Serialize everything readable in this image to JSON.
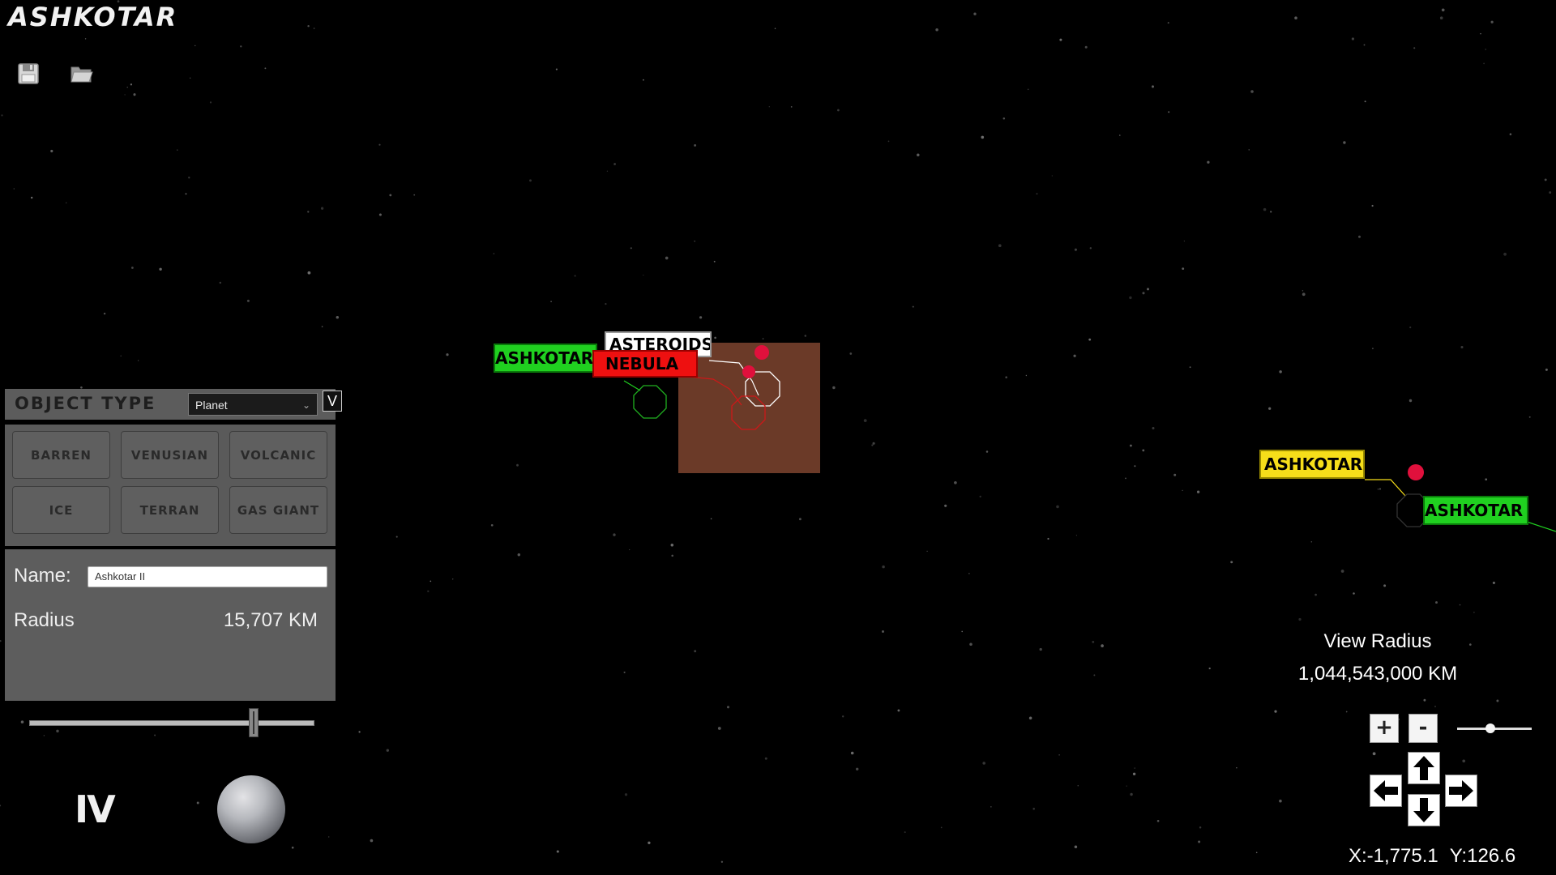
{
  "app": {
    "title": "ASHKOTAR"
  },
  "toolbar": {
    "save_icon": "save-icon",
    "open_icon": "open-folder-icon"
  },
  "object_type": {
    "label": "OBJECT TYPE",
    "selected": "Planet",
    "toggle_label": "V"
  },
  "planet_types": [
    "BARREN",
    "VENUSIAN",
    "VOLCANIC",
    "ICE",
    "TERRAN",
    "GAS GIANT"
  ],
  "properties": {
    "name_label": "Name:",
    "name_value": "Ashkotar II",
    "radius_label": "Radius",
    "radius_value": "15,707 KM",
    "radius_slider_fraction": 0.79
  },
  "preview": {
    "index_numeral": "IV",
    "planet_icon": "planet-preview"
  },
  "map_labels": {
    "ashkotar_green_1": "ASHKOTAR",
    "asteroids": "ASTEROIDS",
    "nebula": "NEBULA",
    "ashkotar_yellow": "ASHKOTAR",
    "ashkotar_green_2": "ASHKOTAR"
  },
  "view": {
    "radius_label": "View Radius",
    "radius_value": "1,044,543,000 KM",
    "zoom_in_label": "+",
    "zoom_out_label": "-",
    "zoom_slider_fraction": 0.45
  },
  "coordinates": {
    "x": "X:-1,775.1",
    "y": "Y:126.6"
  },
  "colors": {
    "background": "#000000",
    "panel": "#5c5c5c",
    "label_green": "#20d020",
    "label_red": "#ee1010",
    "label_yellow": "#f6de1a",
    "nebula_region": "#6b3a28",
    "marker_red": "#e0103c"
  }
}
